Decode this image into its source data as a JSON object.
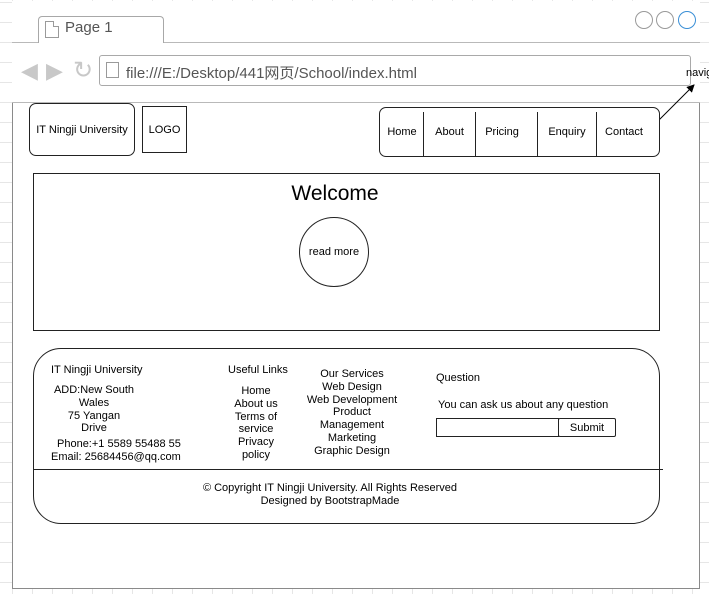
{
  "browser": {
    "tab_title": "Page 1",
    "address": "file:///E:/Desktop/441网页/School/index.html",
    "callout_label": "navig"
  },
  "header": {
    "brand": "IT Ningji University",
    "logo": "LOGO",
    "nav": [
      "Home",
      "About",
      "Pricing",
      "Enquiry",
      "Contact"
    ]
  },
  "hero": {
    "title": "Welcome",
    "button": "read more"
  },
  "footer": {
    "university": {
      "name": "IT Ningji University",
      "address_lines": [
        "ADD:New South",
        "Wales",
        "75 Yangan",
        "Drive"
      ],
      "phone": "Phone:+1 5589 55488 55",
      "email": "Email: 25684456@qq.com"
    },
    "links": {
      "heading": "Useful Links",
      "items": [
        "Home",
        "About us",
        "Terms of",
        "service",
        "Privacy",
        "policy"
      ]
    },
    "services": {
      "heading": "Our Services",
      "items": [
        "Web Design",
        "Web Development",
        "Product",
        "Management",
        "Marketing",
        "Graphic Design"
      ]
    },
    "question": {
      "heading": "Question",
      "text": "You can ask us about any question",
      "input_value": "",
      "submit": "Submit"
    },
    "copyright": "© Copyright IT Ningji University. All Rights Reserved",
    "credit": "Designed by BootstrapMade"
  }
}
